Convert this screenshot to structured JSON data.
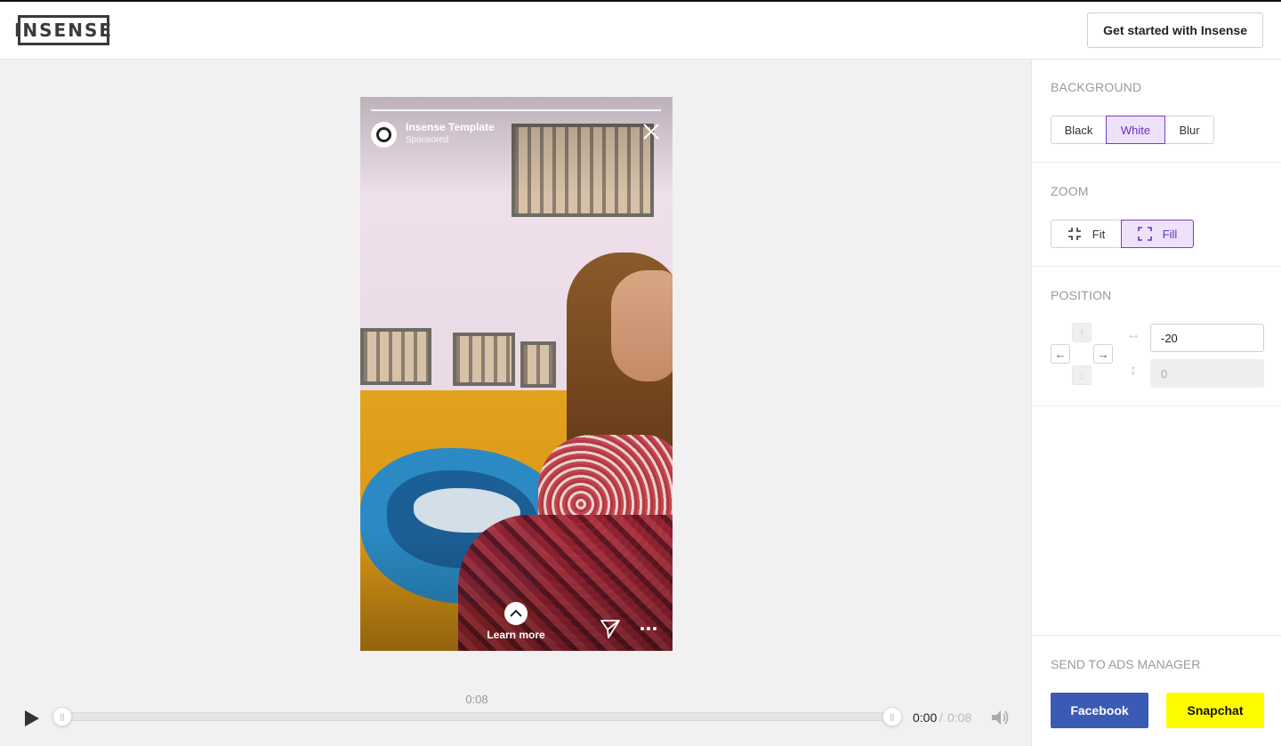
{
  "header": {
    "logo_text": "INSENSE",
    "cta_label": "Get started with Insense"
  },
  "story": {
    "account_name": "Insense Template",
    "sponsored_label": "Sponsored",
    "close_icon": "close-icon",
    "cta_label": "Learn more",
    "send_icon": "paper-plane-icon",
    "more_icon": "ellipsis-icon"
  },
  "timeline": {
    "marker_time": "0:08",
    "current_time": "0:00",
    "separator": "/",
    "total_time": "0:08",
    "play_icon": "play-icon",
    "volume_icon": "volume-icon"
  },
  "panel": {
    "background": {
      "title": "BACKGROUND",
      "options": [
        "Black",
        "White",
        "Blur"
      ],
      "selected": "White"
    },
    "zoom": {
      "title": "ZOOM",
      "options": [
        "Fit",
        "Fill"
      ],
      "selected": "Fill"
    },
    "position": {
      "title": "POSITION",
      "x_value": "-20",
      "y_value": "0"
    },
    "ads": {
      "title": "SEND TO ADS MANAGER",
      "facebook_label": "Facebook",
      "snapchat_label": "Snapchat"
    }
  },
  "colors": {
    "accent": "#7a3ccb",
    "accent_bg": "#eee2fb",
    "facebook": "#3b5ab4",
    "snapchat": "#fffc00"
  }
}
